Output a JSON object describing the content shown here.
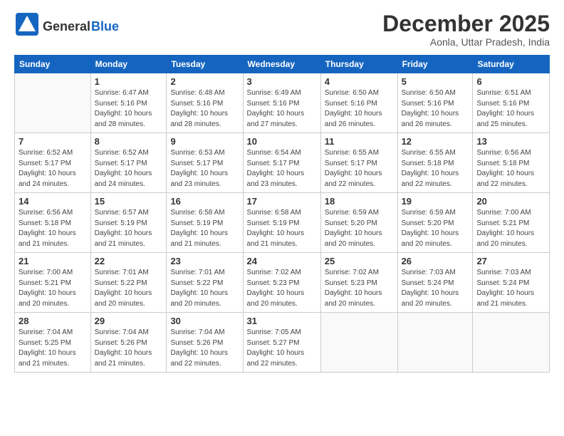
{
  "logo": {
    "general": "General",
    "blue": "Blue"
  },
  "header": {
    "month": "December 2025",
    "location": "Aonla, Uttar Pradesh, India"
  },
  "days_of_week": [
    "Sunday",
    "Monday",
    "Tuesday",
    "Wednesday",
    "Thursday",
    "Friday",
    "Saturday"
  ],
  "weeks": [
    [
      {
        "num": "",
        "info": ""
      },
      {
        "num": "1",
        "info": "Sunrise: 6:47 AM\nSunset: 5:16 PM\nDaylight: 10 hours\nand 28 minutes."
      },
      {
        "num": "2",
        "info": "Sunrise: 6:48 AM\nSunset: 5:16 PM\nDaylight: 10 hours\nand 28 minutes."
      },
      {
        "num": "3",
        "info": "Sunrise: 6:49 AM\nSunset: 5:16 PM\nDaylight: 10 hours\nand 27 minutes."
      },
      {
        "num": "4",
        "info": "Sunrise: 6:50 AM\nSunset: 5:16 PM\nDaylight: 10 hours\nand 26 minutes."
      },
      {
        "num": "5",
        "info": "Sunrise: 6:50 AM\nSunset: 5:16 PM\nDaylight: 10 hours\nand 26 minutes."
      },
      {
        "num": "6",
        "info": "Sunrise: 6:51 AM\nSunset: 5:16 PM\nDaylight: 10 hours\nand 25 minutes."
      }
    ],
    [
      {
        "num": "7",
        "info": "Sunrise: 6:52 AM\nSunset: 5:17 PM\nDaylight: 10 hours\nand 24 minutes."
      },
      {
        "num": "8",
        "info": "Sunrise: 6:52 AM\nSunset: 5:17 PM\nDaylight: 10 hours\nand 24 minutes."
      },
      {
        "num": "9",
        "info": "Sunrise: 6:53 AM\nSunset: 5:17 PM\nDaylight: 10 hours\nand 23 minutes."
      },
      {
        "num": "10",
        "info": "Sunrise: 6:54 AM\nSunset: 5:17 PM\nDaylight: 10 hours\nand 23 minutes."
      },
      {
        "num": "11",
        "info": "Sunrise: 6:55 AM\nSunset: 5:17 PM\nDaylight: 10 hours\nand 22 minutes."
      },
      {
        "num": "12",
        "info": "Sunrise: 6:55 AM\nSunset: 5:18 PM\nDaylight: 10 hours\nand 22 minutes."
      },
      {
        "num": "13",
        "info": "Sunrise: 6:56 AM\nSunset: 5:18 PM\nDaylight: 10 hours\nand 22 minutes."
      }
    ],
    [
      {
        "num": "14",
        "info": "Sunrise: 6:56 AM\nSunset: 5:18 PM\nDaylight: 10 hours\nand 21 minutes."
      },
      {
        "num": "15",
        "info": "Sunrise: 6:57 AM\nSunset: 5:19 PM\nDaylight: 10 hours\nand 21 minutes."
      },
      {
        "num": "16",
        "info": "Sunrise: 6:58 AM\nSunset: 5:19 PM\nDaylight: 10 hours\nand 21 minutes."
      },
      {
        "num": "17",
        "info": "Sunrise: 6:58 AM\nSunset: 5:19 PM\nDaylight: 10 hours\nand 21 minutes."
      },
      {
        "num": "18",
        "info": "Sunrise: 6:59 AM\nSunset: 5:20 PM\nDaylight: 10 hours\nand 20 minutes."
      },
      {
        "num": "19",
        "info": "Sunrise: 6:59 AM\nSunset: 5:20 PM\nDaylight: 10 hours\nand 20 minutes."
      },
      {
        "num": "20",
        "info": "Sunrise: 7:00 AM\nSunset: 5:21 PM\nDaylight: 10 hours\nand 20 minutes."
      }
    ],
    [
      {
        "num": "21",
        "info": "Sunrise: 7:00 AM\nSunset: 5:21 PM\nDaylight: 10 hours\nand 20 minutes."
      },
      {
        "num": "22",
        "info": "Sunrise: 7:01 AM\nSunset: 5:22 PM\nDaylight: 10 hours\nand 20 minutes."
      },
      {
        "num": "23",
        "info": "Sunrise: 7:01 AM\nSunset: 5:22 PM\nDaylight: 10 hours\nand 20 minutes."
      },
      {
        "num": "24",
        "info": "Sunrise: 7:02 AM\nSunset: 5:23 PM\nDaylight: 10 hours\nand 20 minutes."
      },
      {
        "num": "25",
        "info": "Sunrise: 7:02 AM\nSunset: 5:23 PM\nDaylight: 10 hours\nand 20 minutes."
      },
      {
        "num": "26",
        "info": "Sunrise: 7:03 AM\nSunset: 5:24 PM\nDaylight: 10 hours\nand 20 minutes."
      },
      {
        "num": "27",
        "info": "Sunrise: 7:03 AM\nSunset: 5:24 PM\nDaylight: 10 hours\nand 21 minutes."
      }
    ],
    [
      {
        "num": "28",
        "info": "Sunrise: 7:04 AM\nSunset: 5:25 PM\nDaylight: 10 hours\nand 21 minutes."
      },
      {
        "num": "29",
        "info": "Sunrise: 7:04 AM\nSunset: 5:26 PM\nDaylight: 10 hours\nand 21 minutes."
      },
      {
        "num": "30",
        "info": "Sunrise: 7:04 AM\nSunset: 5:26 PM\nDaylight: 10 hours\nand 22 minutes."
      },
      {
        "num": "31",
        "info": "Sunrise: 7:05 AM\nSunset: 5:27 PM\nDaylight: 10 hours\nand 22 minutes."
      },
      {
        "num": "",
        "info": ""
      },
      {
        "num": "",
        "info": ""
      },
      {
        "num": "",
        "info": ""
      }
    ]
  ]
}
